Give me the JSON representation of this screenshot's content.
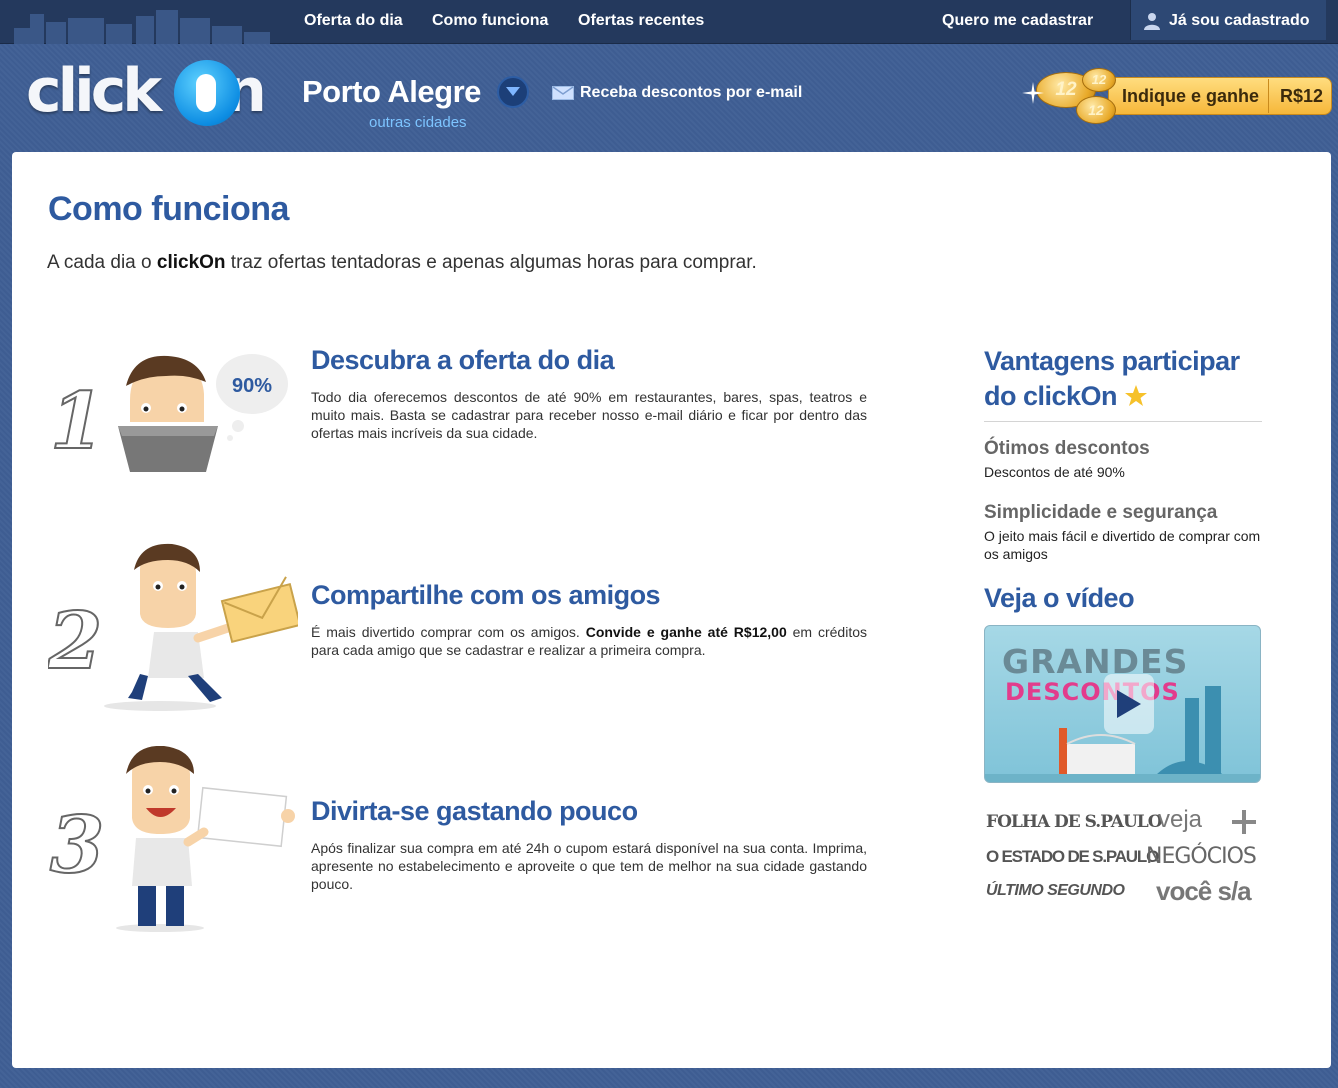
{
  "topnav": {
    "items": [
      "Oferta do dia",
      "Como funciona",
      "Ofertas recentes"
    ],
    "signup": "Quero me cadastrar",
    "login": "Já sou cadastrado"
  },
  "header": {
    "logo_text": "clickOn",
    "city": "Porto Alegre",
    "other_cities": "outras cidades",
    "email_signup": "Receba descontos por e-mail",
    "refer_label": "Indique e ganhe",
    "refer_value": "R$12",
    "coin_value": "12"
  },
  "main": {
    "title": "Como funciona",
    "intro_pre": "A cada dia o ",
    "intro_brand": "clickOn",
    "intro_post": " traz ofertas tentadoras e apenas algumas horas para comprar.",
    "steps": [
      {
        "number": "1",
        "title": "Descubra a oferta do dia",
        "bubble": "90%",
        "text": "Todo dia oferecemos descontos de até 90% em restaurantes, bares, spas, teatros e muito mais. Basta se cadastrar para receber nosso e-mail diário e ficar por dentro das ofertas mais incríveis da sua cidade."
      },
      {
        "number": "2",
        "title": "Compartilhe com os amigos",
        "text_pre": "É mais divertido comprar com os amigos. ",
        "text_bold": "Convide e ganhe até R$12,00",
        "text_post": " em créditos para cada amigo que se cadastrar e realizar a primeira compra."
      },
      {
        "number": "3",
        "title": "Divirta-se gastando pouco",
        "text": "Após finalizar sua compra em até 24h o cupom estará disponível na sua conta. Imprima, apresente no estabelecimento e aproveite o que tem de melhor na sua cidade gastando pouco."
      }
    ]
  },
  "sidebar": {
    "title": "Vantagens participar do clickOn",
    "advantages": [
      {
        "title": "Ótimos descontos",
        "text": "Descontos de até 90%"
      },
      {
        "title": "Simplicidade e segurança",
        "text": "O jeito mais fácil e divertido de comprar com os amigos"
      }
    ],
    "video_title": "Veja o vídeo",
    "video_line1": "GRANDES",
    "video_line2": "DESCONTOS",
    "press": [
      "FOLHA DE S.PAULO",
      "veja",
      "O ESTADO DE S.PAULO",
      "NEGÓCIOS",
      "ÚLTIMO SEGUNDO",
      "você s/a"
    ]
  },
  "colors": {
    "accent": "#2e5aa0",
    "background": "#3f5f95",
    "topbar": "#24395d",
    "refer": "#f6b73a"
  }
}
